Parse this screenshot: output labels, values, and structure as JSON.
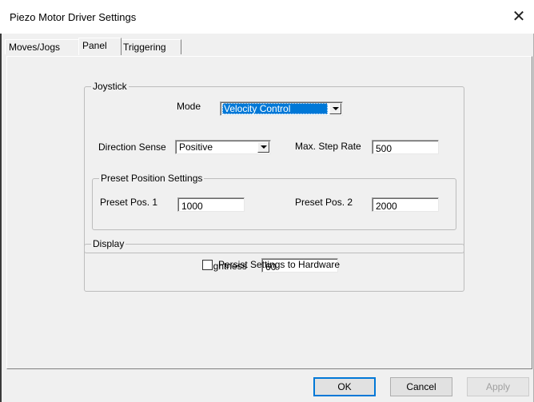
{
  "window": {
    "title": "Piezo Motor Driver Settings",
    "close_glyph": "✕"
  },
  "tabs": [
    {
      "label": "Moves/Jogs",
      "active": false
    },
    {
      "label": "Panel",
      "active": true
    },
    {
      "label": "Triggering",
      "active": false
    }
  ],
  "joystick": {
    "group_label": "Joystick",
    "mode_label": "Mode",
    "mode_value": "Velocity Control",
    "direction_label": "Direction Sense",
    "direction_value": "Positive",
    "max_step_label": "Max. Step Rate",
    "max_step_value": "500",
    "preset": {
      "group_label": "Preset Position Settings",
      "pos1_label": "Preset Pos. 1",
      "pos1_value": "1000",
      "pos2_label": "Preset Pos. 2",
      "pos2_value": "2000"
    }
  },
  "display": {
    "group_label": "Display",
    "brightness_label": "Brightness",
    "brightness_value": "60"
  },
  "persist": {
    "label": "Persist Settings to Hardware",
    "checked": false
  },
  "buttons": {
    "ok": "OK",
    "cancel": "Cancel",
    "apply": "Apply"
  },
  "colors": {
    "selection": "#0078d7",
    "dialog_bg": "#f0f0f0"
  }
}
